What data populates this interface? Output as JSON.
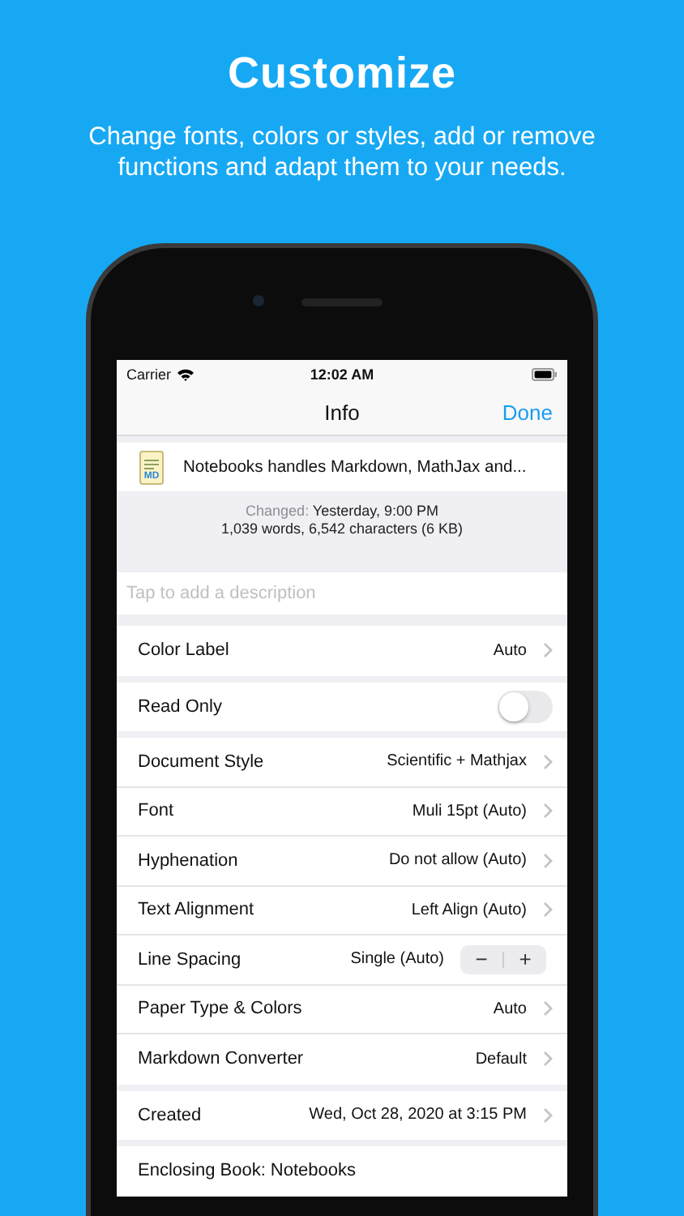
{
  "promo": {
    "title": "Customize",
    "subtitle": "Change fonts, colors or styles, add or remove functions and adapt them to your needs."
  },
  "status_bar": {
    "carrier": "Carrier",
    "time": "12:02 AM"
  },
  "nav": {
    "title": "Info",
    "action": "Done"
  },
  "document": {
    "icon_text": "MD",
    "title": "Notebooks handles Markdown, MathJax and...",
    "changed_label": "Changed:",
    "changed_value": "Yesterday, 9:00 PM",
    "stats": "1,039 words, 6,542 characters (6 KB)"
  },
  "description": {
    "placeholder": "Tap to add a description"
  },
  "sections": [
    {
      "rows": [
        {
          "kind": "disclosure",
          "label": "Color Label",
          "value": "Auto"
        }
      ]
    },
    {
      "rows": [
        {
          "kind": "toggle",
          "label": "Read Only",
          "on": false
        }
      ]
    },
    {
      "rows": [
        {
          "kind": "disclosure",
          "label": "Document Style",
          "value": "Scientific + Mathjax"
        },
        {
          "kind": "disclosure",
          "label": "Font",
          "value": "Muli 15pt (Auto)"
        },
        {
          "kind": "disclosure",
          "label": "Hyphenation",
          "value": "Do not allow (Auto)"
        },
        {
          "kind": "disclosure",
          "label": "Text Alignment",
          "value": "Left Align (Auto)"
        },
        {
          "kind": "stepper",
          "label": "Line Spacing",
          "value": "Single (Auto)",
          "decrement": "−",
          "increment": "+"
        },
        {
          "kind": "disclosure",
          "label": "Paper Type & Colors",
          "value": "Auto"
        },
        {
          "kind": "disclosure",
          "label": "Markdown Converter",
          "value": "Default"
        }
      ]
    },
    {
      "rows": [
        {
          "kind": "disclosure",
          "label": "Created",
          "value": "Wed, Oct 28, 2020 at 3:15 PM"
        }
      ]
    },
    {
      "rows": [
        {
          "kind": "plain",
          "label": "Enclosing Book: Notebooks"
        }
      ]
    }
  ]
}
